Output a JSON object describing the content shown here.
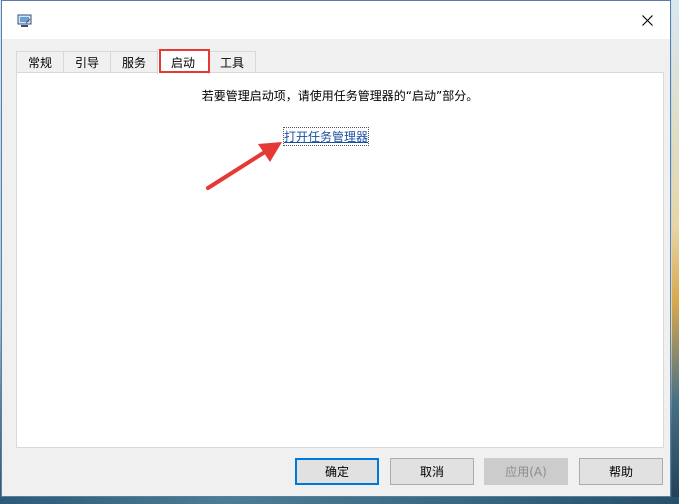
{
  "window": {
    "icon": "msconfig-computer-icon",
    "close_icon": "close-icon"
  },
  "tabs": [
    {
      "label": "常规"
    },
    {
      "label": "引导"
    },
    {
      "label": "服务"
    },
    {
      "label": "启动"
    },
    {
      "label": "工具"
    }
  ],
  "selected_tab": "启动",
  "startup_panel": {
    "info_text": "若要管理启动项，请使用任务管理器的“启动”部分。",
    "link_text": "打开任务管理器"
  },
  "buttons": {
    "ok": "确定",
    "cancel": "取消",
    "apply": "应用(A)",
    "help": "帮助"
  },
  "annotation": {
    "highlight_color": "#e53935",
    "arrow_color": "#e53935"
  }
}
